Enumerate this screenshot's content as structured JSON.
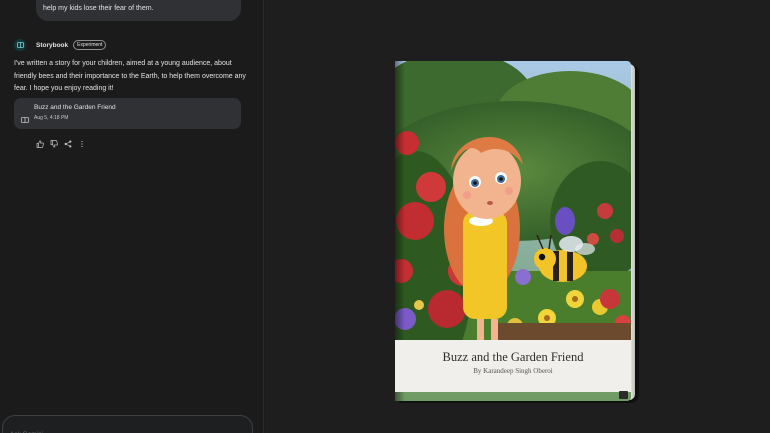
{
  "user_message": {
    "text_tail": "help my kids lose their fear of them."
  },
  "response": {
    "app_name": "Storybook",
    "badge": "Experiment",
    "text": "I've written a story for your children, aimed at a young audience, about friendly bees and their importance to the Earth, to help them overcome any fear. I hope you enjoy reading it!",
    "card": {
      "title": "Buzz and the Garden Friend",
      "date": "Aug 5, 4:18 PM",
      "icon": "book-icon"
    },
    "actions": [
      "thumb-up-icon",
      "thumb-down-icon",
      "share-icon",
      "more-vert-icon"
    ]
  },
  "input": {
    "placeholder": "Ask Gemini"
  },
  "book": {
    "title": "Buzz and the Garden Friend",
    "author": "By Karandeep Singh Oberoi"
  },
  "colors": {
    "background": "#1b1b1c",
    "surface": "#303134",
    "accent_icon_bg": "#12383b",
    "accent_icon_fg": "#7fcfd6"
  }
}
